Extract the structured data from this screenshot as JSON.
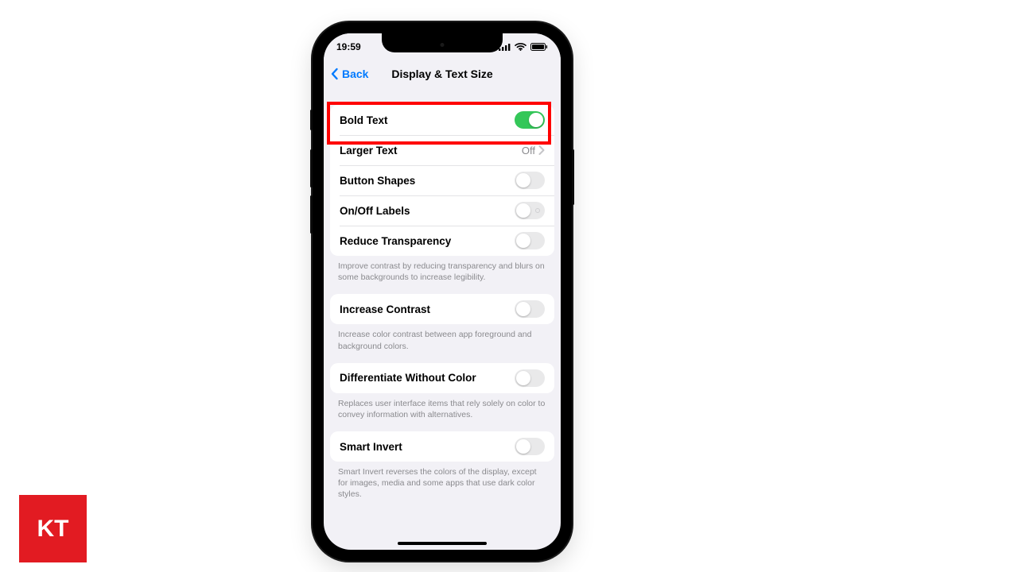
{
  "watermark": {
    "text": "KT"
  },
  "status": {
    "time": "19:59"
  },
  "nav": {
    "back": "Back",
    "title": "Display & Text Size"
  },
  "groups": [
    {
      "rows": [
        {
          "label": "Bold Text",
          "type": "toggle",
          "on": true
        },
        {
          "label": "Larger Text",
          "type": "link",
          "value": "Off"
        },
        {
          "label": "Button Shapes",
          "type": "toggle",
          "on": false
        },
        {
          "label": "On/Off Labels",
          "type": "toggle",
          "on": false,
          "mark": true
        },
        {
          "label": "Reduce Transparency",
          "type": "toggle",
          "on": false
        }
      ],
      "footer": "Improve contrast by reducing transparency and blurs on some backgrounds to increase legibility."
    },
    {
      "rows": [
        {
          "label": "Increase Contrast",
          "type": "toggle",
          "on": false
        }
      ],
      "footer": "Increase color contrast between app foreground and background colors."
    },
    {
      "rows": [
        {
          "label": "Differentiate Without Color",
          "type": "toggle",
          "on": false
        }
      ],
      "footer": "Replaces user interface items that rely solely on color to convey information with alternatives."
    },
    {
      "rows": [
        {
          "label": "Smart Invert",
          "type": "toggle",
          "on": false
        }
      ],
      "footer": "Smart Invert reverses the colors of the display, except for images, media and some apps that use dark color styles."
    }
  ],
  "highlight": {
    "row_label": "Bold Text"
  }
}
